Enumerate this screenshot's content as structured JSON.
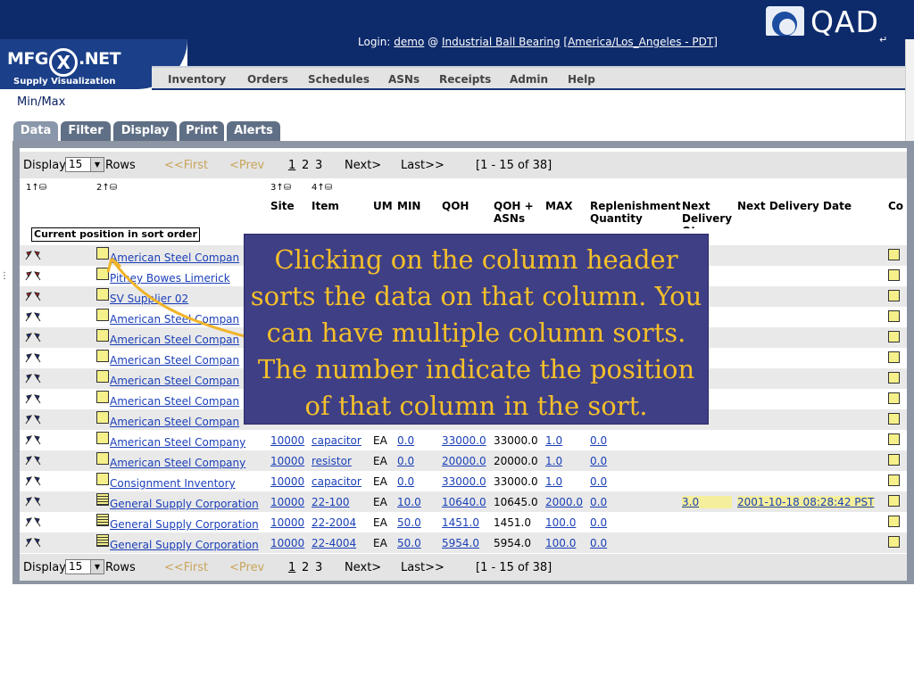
{
  "header": {
    "brand_logo_text": "QAD",
    "app_logo_text": "MFG.NET",
    "app_logo_subtitle": "Supply Visualization",
    "login_label": "Login:",
    "login_user": "demo",
    "login_at": "@",
    "login_company": "Industrial Ball Bearing",
    "login_timezone": "[America/Los_Angeles - PDT]",
    "logout_icon": "logout-icon"
  },
  "nav": {
    "items": [
      "Inventory",
      "Orders",
      "Schedules",
      "ASNs",
      "Receipts",
      "Admin",
      "Help"
    ]
  },
  "page": {
    "title": "Min/Max"
  },
  "tabs": [
    "Data",
    "Filter",
    "Display",
    "Print",
    "Alerts"
  ],
  "pager": {
    "display_label": "Display",
    "rows_per_page": "15",
    "rows_label": "Rows",
    "first": "<<First",
    "prev": "<Prev",
    "pages": [
      "1",
      "2",
      "3"
    ],
    "next": "Next>",
    "last": "Last>>",
    "range": "[1 - 15  of  38]"
  },
  "columns": {
    "sort_1": "1↑⛁",
    "sort_2": "2↑⛁",
    "sort_3": "3↑⛁",
    "sort_4": "4↑⛁",
    "tooltip": "Current position in sort order",
    "site": "Site",
    "item": "Item",
    "um": "UM",
    "min": "MIN",
    "qoh": "QOH",
    "qoh_asns": "QOH + ASNs",
    "max": "MAX",
    "replenishment": "Replenishment Quantity",
    "next_delivery_qty": "Next Delivery Qty",
    "next_delivery_date": "Next Delivery Date",
    "co": "Co"
  },
  "rows": [
    {
      "flag": "red",
      "supplier": "American Steel Compan",
      "site": "",
      "item": "",
      "um": "",
      "min": "",
      "qoh": "",
      "qoh_asns": "",
      "max": "",
      "repl": "",
      "ndq": "",
      "ndd": ""
    },
    {
      "flag": "red",
      "supplier": "Pitney Bowes Limerick",
      "site": "",
      "item": "",
      "um": "",
      "min": "",
      "qoh": "",
      "qoh_asns": "",
      "max": "",
      "repl": "",
      "ndq": "",
      "ndd": ""
    },
    {
      "flag": "red",
      "supplier": "SV Supplier 02",
      "site": "",
      "item": "",
      "um": "",
      "min": "",
      "qoh": "",
      "qoh_asns": "",
      "max": "",
      "repl": "",
      "ndq": "",
      "ndd": ""
    },
    {
      "flag": "blue",
      "supplier": "American Steel Compan",
      "site": "",
      "item": "",
      "um": "",
      "min": "",
      "qoh": "",
      "qoh_asns": "",
      "max": "",
      "repl": "",
      "ndq": "",
      "ndd": ""
    },
    {
      "flag": "blue",
      "supplier": "American Steel Compan",
      "site": "",
      "item": "",
      "um": "",
      "min": "",
      "qoh": "",
      "qoh_asns": "",
      "max": "",
      "repl": "",
      "ndq": "",
      "ndd": ""
    },
    {
      "flag": "blue",
      "supplier": "American Steel Compan",
      "site": "",
      "item": "",
      "um": "",
      "min": "",
      "qoh": "",
      "qoh_asns": "",
      "max": "",
      "repl": "",
      "ndq": "",
      "ndd": ""
    },
    {
      "flag": "blue",
      "supplier": "American Steel Compan",
      "site": "",
      "item": "",
      "um": "",
      "min": "",
      "qoh": "",
      "qoh_asns": "",
      "max": "",
      "repl": "",
      "ndq": "",
      "ndd": ""
    },
    {
      "flag": "blue",
      "supplier": "American Steel Compan",
      "site": "",
      "item": "",
      "um": "",
      "min": "",
      "qoh": "",
      "qoh_asns": "",
      "max": "",
      "repl": "",
      "ndq": "",
      "ndd": ""
    },
    {
      "flag": "blue",
      "supplier": "American Steel Compan",
      "site": "",
      "item": "",
      "um": "",
      "min": "",
      "qoh": "",
      "qoh_asns": "",
      "max": "",
      "repl": "",
      "ndq": "",
      "ndd": ""
    },
    {
      "flag": "blue",
      "supplier": "American Steel Company",
      "site": "10000",
      "item": "capacitor",
      "um": "EA",
      "min": "0.0",
      "qoh": "33000.0",
      "qoh_asns": "33000.0",
      "max": "1.0",
      "repl": "0.0",
      "ndq": "",
      "ndd": ""
    },
    {
      "flag": "blue",
      "supplier": "American Steel Company",
      "site": "10000",
      "item": "resistor",
      "um": "EA",
      "min": "0.0",
      "qoh": "20000.0",
      "qoh_asns": "20000.0",
      "max": "1.0",
      "repl": "0.0",
      "ndq": "",
      "ndd": ""
    },
    {
      "flag": "blue",
      "supplier": "Consignment Inventory",
      "site": "10000",
      "item": "capacitor",
      "um": "EA",
      "min": "0.0",
      "qoh": "33000.0",
      "qoh_asns": "33000.0",
      "max": "1.0",
      "repl": "0.0",
      "ndq": "",
      "ndd": ""
    },
    {
      "flag": "blue",
      "supplier": "General Supply Corporation",
      "site": "10000",
      "item": "22-100",
      "um": "EA",
      "min": "10.0",
      "qoh": "10640.0",
      "qoh_asns": "10645.0",
      "max": "2000.0",
      "repl": "0.0",
      "ndq": "3.0",
      "ndd": "2001-10-18 08:28:42 PST"
    },
    {
      "flag": "blue",
      "supplier": "General Supply Corporation",
      "site": "10000",
      "item": "22-2004",
      "um": "EA",
      "min": "50.0",
      "qoh": "1451.0",
      "qoh_asns": "1451.0",
      "max": "100.0",
      "repl": "0.0",
      "ndq": "",
      "ndd": ""
    },
    {
      "flag": "blue",
      "supplier": "General Supply Corporation",
      "site": "10000",
      "item": "22-4004",
      "um": "EA",
      "min": "50.0",
      "qoh": "5954.0",
      "qoh_asns": "5954.0",
      "max": "100.0",
      "repl": "0.0",
      "ndq": "",
      "ndd": ""
    }
  ],
  "callout": {
    "text": "Clicking on the column header sorts the data on that column. You can have multiple column sorts. The number indicate the position of that column in the sort."
  },
  "colors": {
    "top_bar": "#0d2a6b",
    "callout_bg": "#3f3f86",
    "callout_text": "#f5c02a",
    "link": "#1a3fb8",
    "arrow": "#f0b429"
  }
}
